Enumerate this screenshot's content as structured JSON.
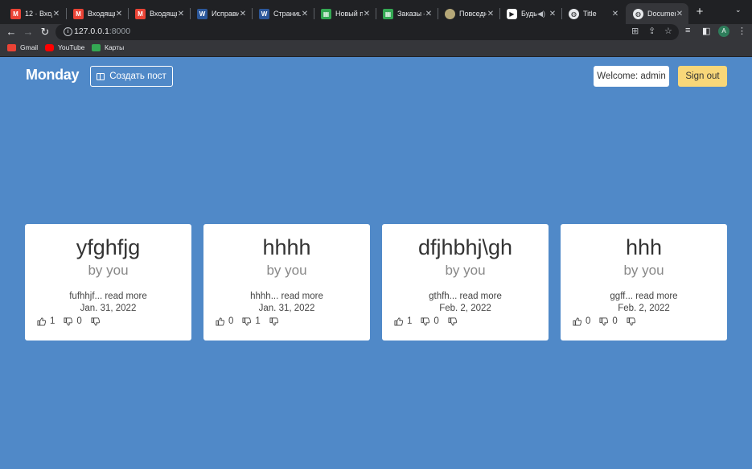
{
  "browser": {
    "tabs": [
      {
        "title": "12 · Входя",
        "icon": "gmail-icon"
      },
      {
        "title": "Входящи",
        "icon": "gmail-icon"
      },
      {
        "title": "Входящи",
        "icon": "gmail-icon"
      },
      {
        "title": "Исправи",
        "icon": "word-icon"
      },
      {
        "title": "Страниц",
        "icon": "word-icon"
      },
      {
        "title": "Новый п",
        "icon": "sheet-icon"
      },
      {
        "title": "Заказы –",
        "icon": "sheet-icon"
      },
      {
        "title": "Повседн",
        "icon": "globe-icon"
      },
      {
        "title": "Будь",
        "icon": "play-icon"
      },
      {
        "title": "Title",
        "icon": "globe-icon"
      },
      {
        "title": "Documen",
        "icon": "globe-icon",
        "active": true
      }
    ],
    "url_host": "127.0.0.1",
    "url_port": ":8000",
    "bookmarks": [
      {
        "label": "Gmail",
        "icon": "gmail-icon"
      },
      {
        "label": "YouTube",
        "icon": "youtube-icon"
      },
      {
        "label": "Карты",
        "icon": "maps-icon"
      }
    ],
    "profile_initial": "A"
  },
  "header": {
    "logo": "Monday",
    "create_post_label": "Создать пост",
    "welcome_label": "Welcome: admin",
    "signout_label": "Sign out"
  },
  "posts": [
    {
      "title": "yfghfjg",
      "author": "by you",
      "excerpt": "fufhhjf... read more",
      "date": "Jan. 31, 2022",
      "likes": "1",
      "dislikes": "0"
    },
    {
      "title": "hhhh",
      "author": "by you",
      "excerpt": "hhhh... read more",
      "date": "Jan. 31, 2022",
      "likes": "0",
      "dislikes": "1"
    },
    {
      "title": "dfjhbhj\\gh",
      "author": "by you",
      "excerpt": "gthfh... read more",
      "date": "Feb. 2, 2022",
      "likes": "1",
      "dislikes": "0"
    },
    {
      "title": "hhh",
      "author": "by you",
      "excerpt": "ggff... read more",
      "date": "Feb. 2, 2022",
      "likes": "0",
      "dislikes": "0"
    }
  ],
  "colors": {
    "page_bg": "#5089c8",
    "signout_bg": "#f8d779",
    "chrome_bg": "#35363a"
  }
}
